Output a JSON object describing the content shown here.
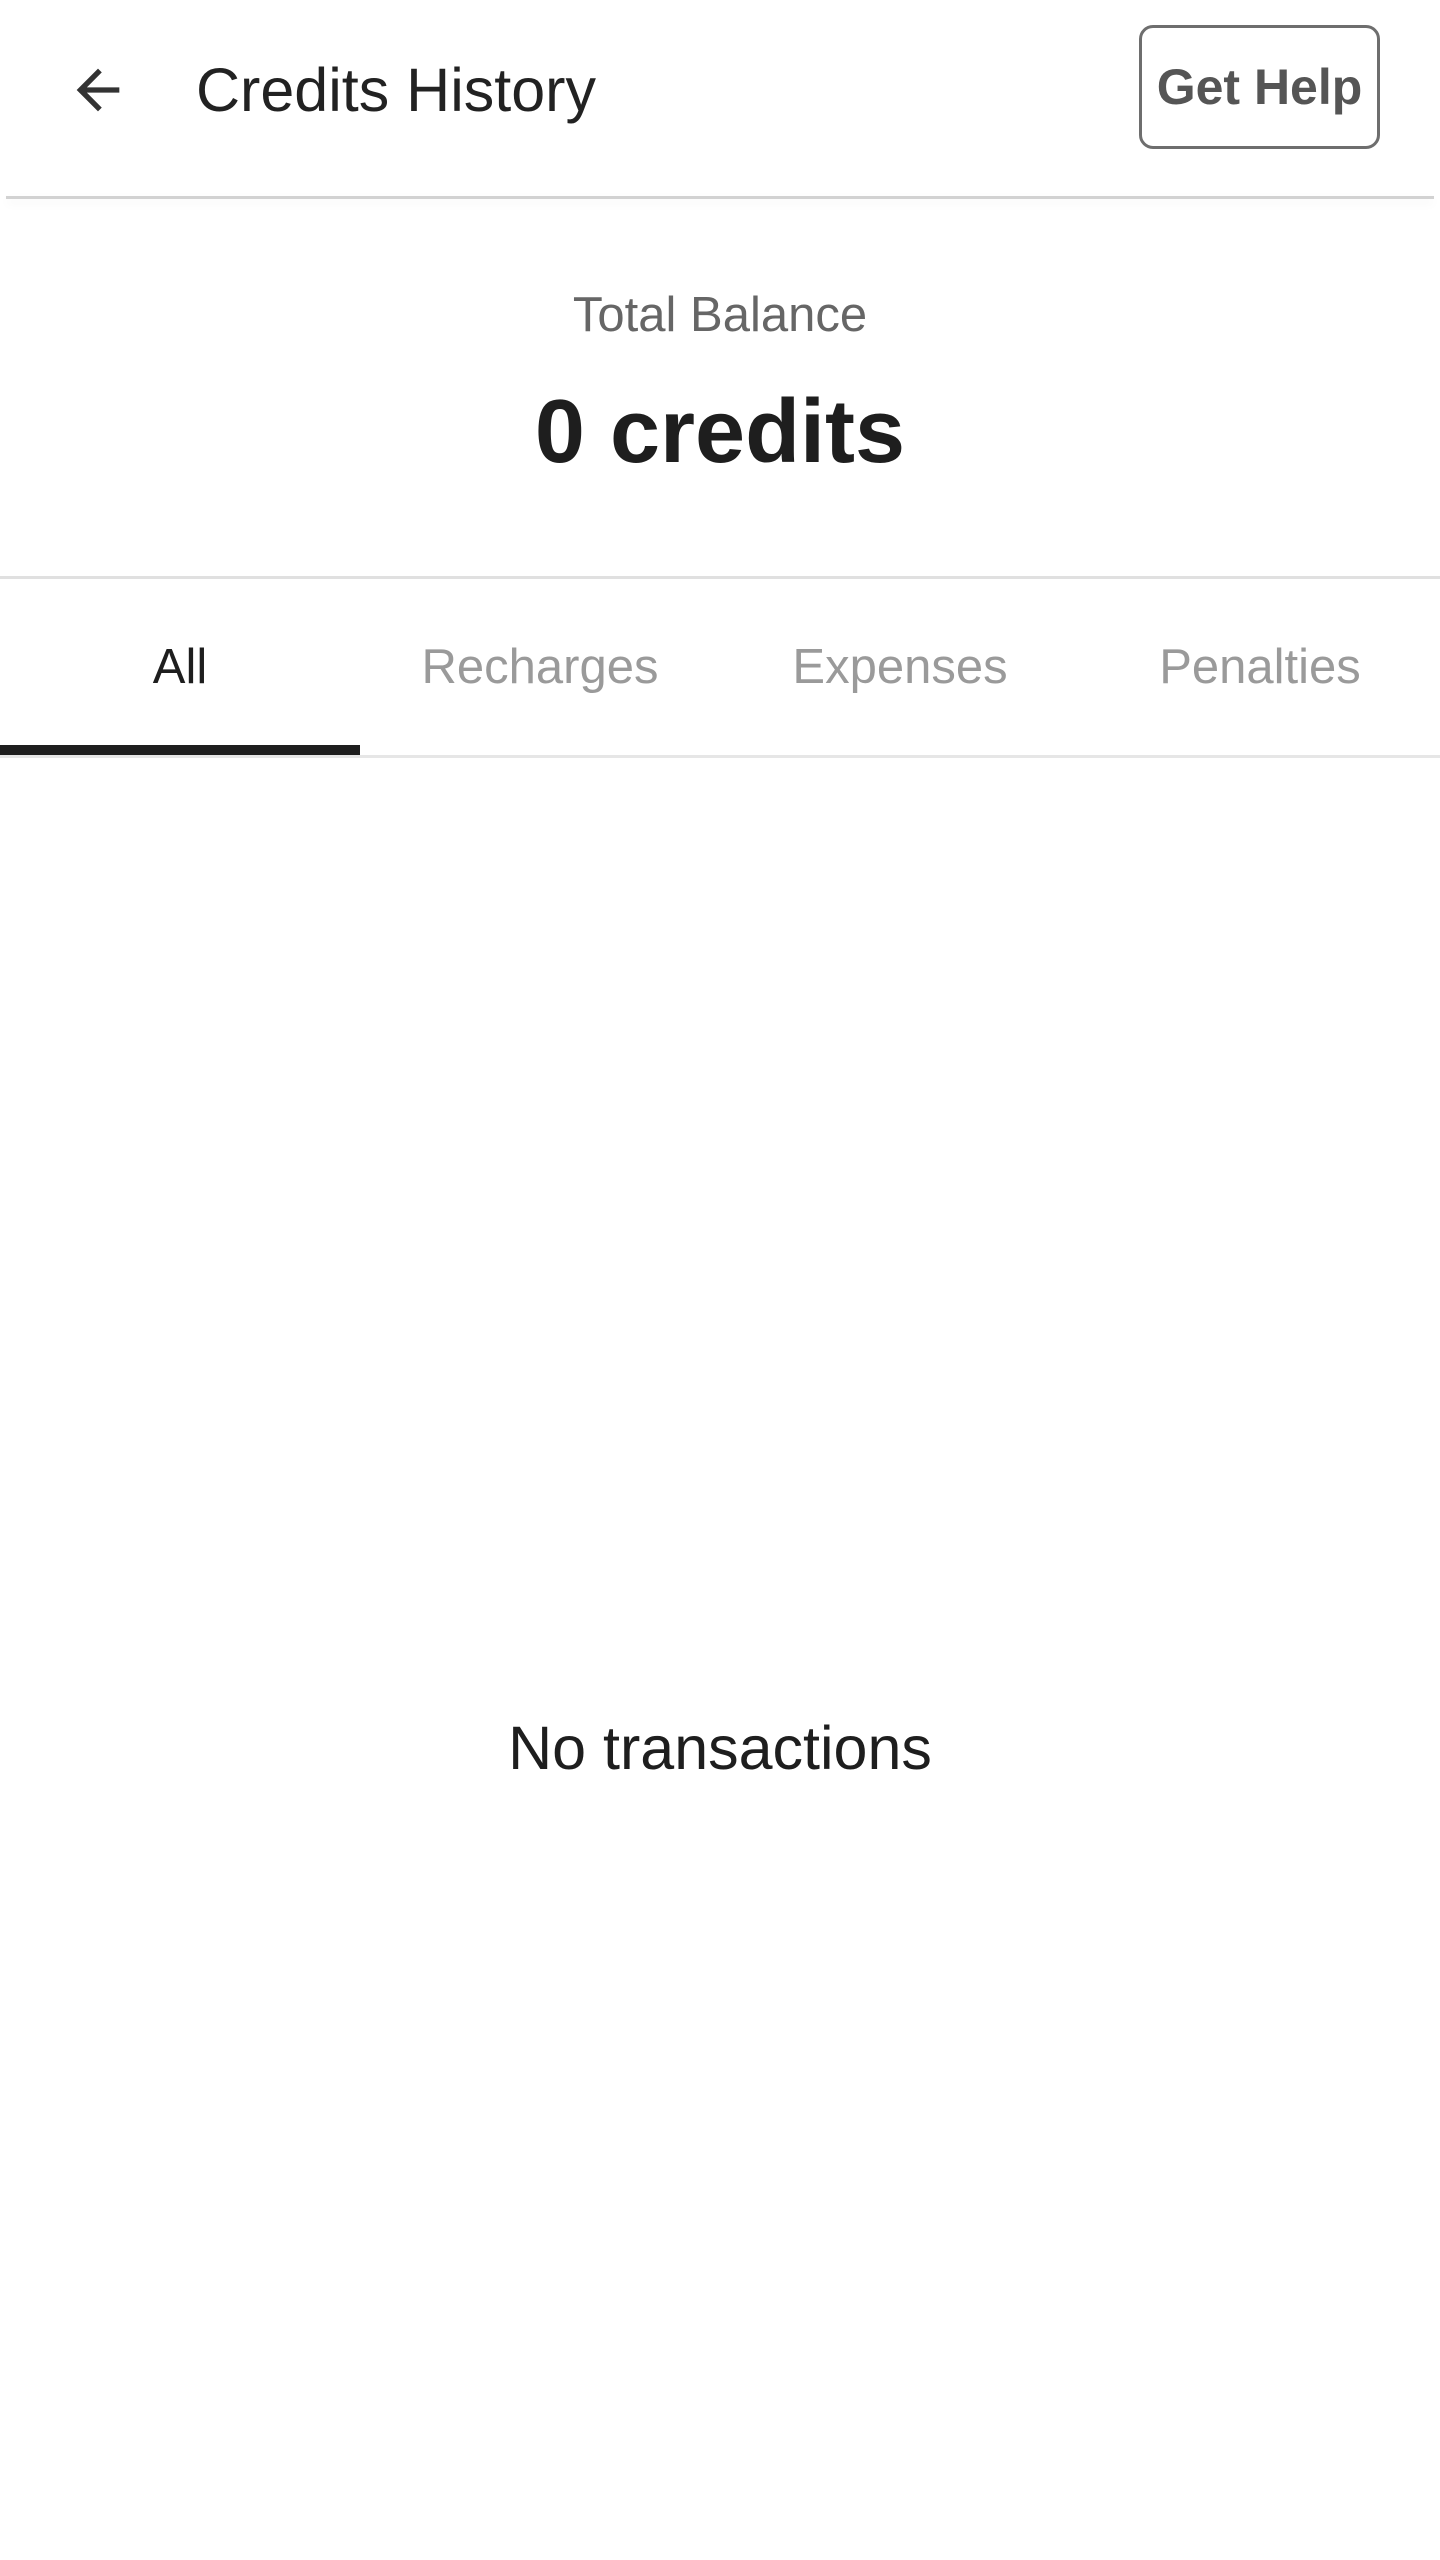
{
  "header": {
    "back_icon": "arrow-left-icon",
    "title": "Credits History",
    "help_label": "Get Help"
  },
  "balance": {
    "label": "Total Balance",
    "value": "0 credits"
  },
  "tabs": [
    {
      "label": "All",
      "active": true
    },
    {
      "label": "Recharges",
      "active": false
    },
    {
      "label": "Expenses",
      "active": false
    },
    {
      "label": "Penalties",
      "active": false
    }
  ],
  "empty_state": {
    "message": "No transactions"
  },
  "colors": {
    "active_tab": "#1e1e1e",
    "inactive_tab": "#9a9a9a",
    "indicator": "#1e1e1e"
  }
}
